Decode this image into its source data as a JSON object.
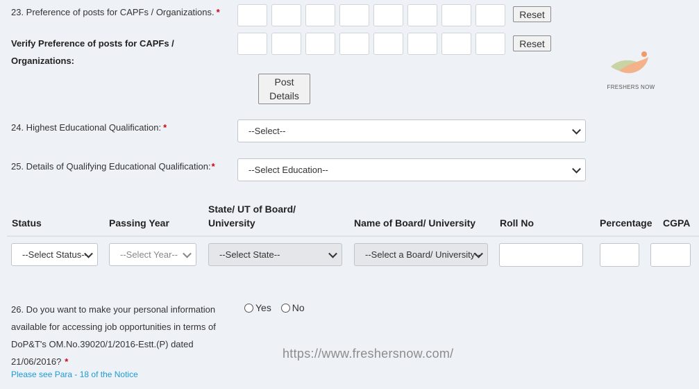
{
  "q23": {
    "label": "23. Preference of posts for CAPFs / Organizations.",
    "required": "*",
    "reset_label": "Reset"
  },
  "verify": {
    "label_line1": "Verify Preference of posts for CAPFs /",
    "label_line2": "Organizations:",
    "reset_label": "Reset"
  },
  "post_details": {
    "line1": "Post",
    "line2": "Details"
  },
  "logo": {
    "text": "FRESHERS NOW"
  },
  "q24": {
    "label": "24. Highest Educational Qualification:",
    "required": "*",
    "selected": "--Select--"
  },
  "q25": {
    "label": "25. Details of Qualifying Educational Qualification:",
    "required": "*",
    "selected": "--Select Education--"
  },
  "table": {
    "headers": {
      "status": "Status",
      "passing_year": "Passing Year",
      "state_line1": "State/ UT of Board/",
      "state_line2": "University",
      "board": "Name of Board/ University",
      "roll_no": "Roll No",
      "percentage": "Percentage",
      "cgpa": "CGPA"
    },
    "row": {
      "status": "--Select Status--",
      "year": "--Select Year--",
      "state": "--Select State--",
      "board": "--Select a Board/ University--"
    }
  },
  "q26": {
    "line1": "26. Do you want to make your personal information",
    "line2": "available for accessing job opportunities in terms of",
    "line3": "DoP&T's OM.No.39020/1/2016-Estt.(P) dated",
    "line4": "21/06/2016?",
    "required": "*",
    "note": "Please see Para - 18 of the Notice",
    "yes_label": "Yes",
    "no_label": "No"
  },
  "watermark": {
    "url": "https://www.freshersnow.com/"
  },
  "colors": {
    "page_bg": "#eef2f7",
    "required": "#d0021b",
    "note": "#1a9bd7"
  }
}
